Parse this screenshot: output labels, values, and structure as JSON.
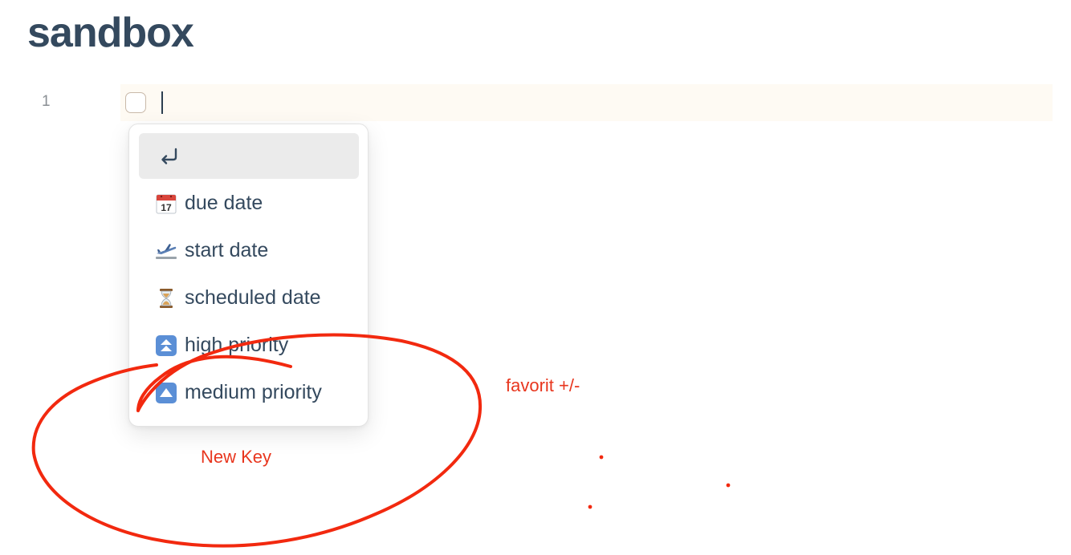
{
  "page": {
    "title": "sandbox"
  },
  "editor": {
    "line_number": "1",
    "current_line_text": ""
  },
  "suggestion_popup": {
    "items": [
      {
        "label": "",
        "icon": "return-key-icon",
        "selected": true
      },
      {
        "label": "due date",
        "icon": "calendar-icon",
        "emoji": "📅"
      },
      {
        "label": "start date",
        "icon": "airplane-departure-icon",
        "emoji": "🛫"
      },
      {
        "label": "scheduled date",
        "icon": "hourglass-icon",
        "emoji": "⏳"
      },
      {
        "label": "high priority",
        "icon": "double-up-arrow-icon",
        "emoji": "⏫"
      },
      {
        "label": "medium priority",
        "icon": "up-triangle-icon",
        "emoji": "🔼"
      }
    ]
  },
  "annotations": {
    "new_key": "New Key",
    "favorit": "favorit +/-",
    "ink_color": "#e8361e"
  },
  "colors": {
    "title": "#34495e",
    "active_line_bg": "#fefaf3",
    "selected_item_bg": "#ebebeb"
  }
}
